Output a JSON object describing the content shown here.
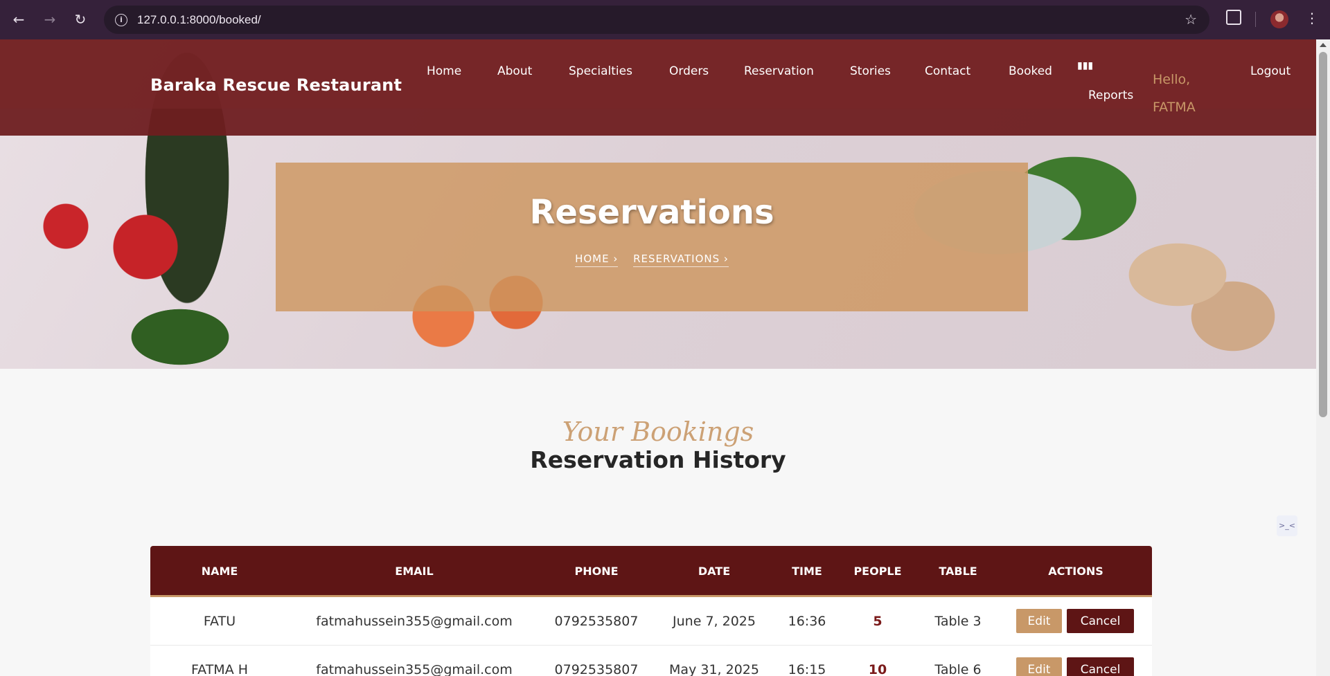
{
  "browser": {
    "url": "127.0.0.1:8000/booked/"
  },
  "navbar": {
    "brand": "Baraka Rescue Restaurant",
    "links": [
      "Home",
      "About",
      "Specialties",
      "Orders",
      "Reservation",
      "Stories",
      "Contact",
      "Booked",
      "Reports"
    ],
    "greeting": "Hello, FATMA",
    "logout": "Logout",
    "reports_icon": "bar-chart-icon"
  },
  "hero": {
    "title": "Reservations",
    "breadcrumbs": [
      "HOME ›",
      "RESERVATIONS ›"
    ]
  },
  "section": {
    "subtitle": "Your Bookings",
    "title": "Reservation History"
  },
  "table": {
    "headers": [
      "NAME",
      "EMAIL",
      "PHONE",
      "DATE",
      "TIME",
      "PEOPLE",
      "TABLE",
      "ACTIONS"
    ],
    "rows": [
      {
        "name": "FATU",
        "email": "fatmahussein355@gmail.com",
        "phone": "0792535807",
        "date": "June 7, 2025",
        "time": "16:36",
        "people": "5",
        "table": "Table 3",
        "edit": "Edit",
        "cancel": "Cancel"
      },
      {
        "name": "FATMA H",
        "email": "fatmahussein355@gmail.com",
        "phone": "0792535807",
        "date": "May 31, 2025",
        "time": "16:15",
        "people": "10",
        "table": "Table 6",
        "edit": "Edit",
        "cancel": "Cancel"
      }
    ]
  },
  "colors": {
    "brand_dark": "#5e1515",
    "accent_gold": "#c89868",
    "chrome_bg": "#35213a"
  }
}
